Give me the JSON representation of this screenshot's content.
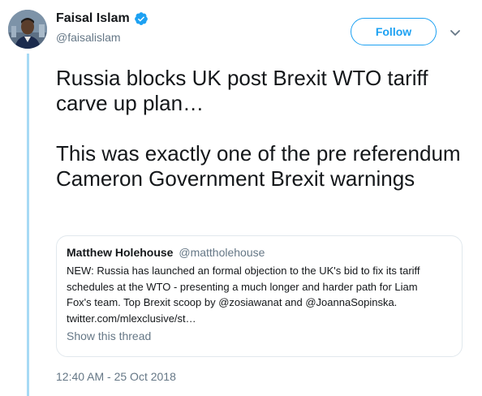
{
  "author": {
    "display_name": "Faisal Islam",
    "handle": "@faisalislam",
    "verified": true
  },
  "follow_button_label": "Follow",
  "tweet": {
    "paragraphs": [
      "Russia blocks UK post Brexit WTO tariff carve up plan…",
      "This was exactly one of the pre referendum Cameron Government Brexit warnings"
    ]
  },
  "quoted_tweet": {
    "display_name": "Matthew Holehouse",
    "handle": "@mattholehouse",
    "lines": [
      "NEW: Russia has launched an formal objection to the UK's bid to fix its tariff",
      "schedules at the WTO - presenting a much longer and harder path for Liam",
      "Fox's team. Top Brexit scoop by @zosiawanat and @JoannaSopinska.",
      "twitter.com/mlexclusive/st…"
    ],
    "show_thread_label": "Show this thread"
  },
  "timestamp": "12:40 AM - 25 Oct 2018",
  "colors": {
    "accent": "#1da1f2",
    "secondary_text": "#657786",
    "thread_line": "#a7daf5",
    "border": "#e1e8ed"
  },
  "icons": {
    "verified": "verified-badge-icon",
    "caret": "chevron-down-icon"
  }
}
